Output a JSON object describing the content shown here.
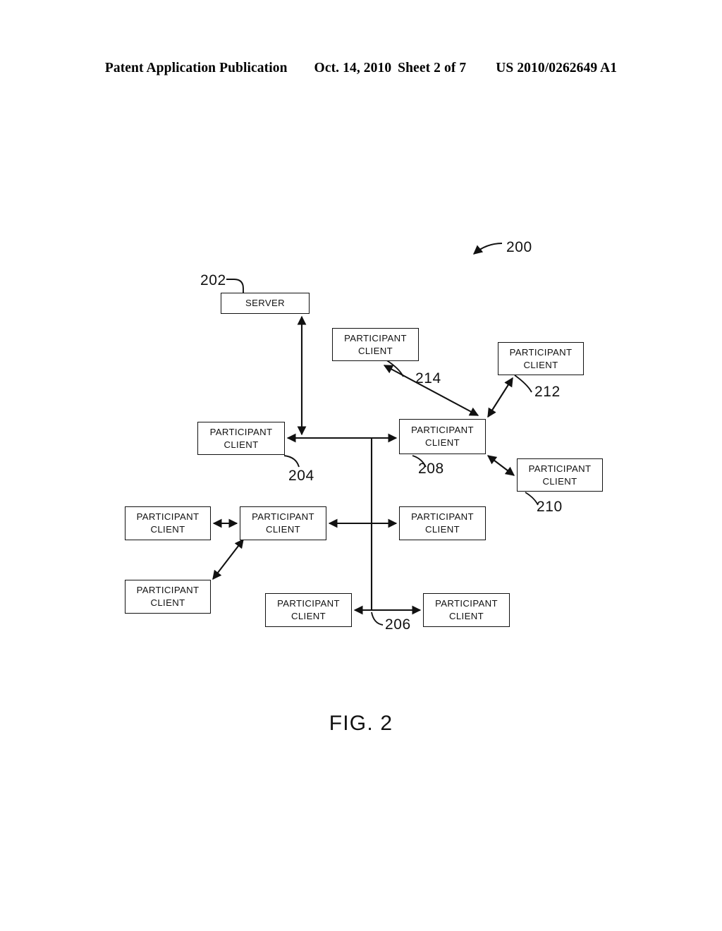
{
  "header": {
    "publication": "Patent Application Publication",
    "date": "Oct. 14, 2010",
    "sheet": "Sheet 2 of 7",
    "patent_number": "US 2010/0262649 A1"
  },
  "figure": {
    "caption": "FIG. 2",
    "diagram_label": "200",
    "node_label_server": "SERVER",
    "node_label_participant_line1": "PARTICIPANT",
    "node_label_participant_line2": "CLIENT"
  },
  "nodes": [
    {
      "id": "server",
      "type": "server",
      "ref": "202",
      "line1": "SERVER",
      "line2": ""
    },
    {
      "id": "n204",
      "type": "participant",
      "ref": "204",
      "line1": "PARTICIPANT",
      "line2": "CLIENT"
    },
    {
      "id": "n208",
      "type": "participant",
      "ref": "208",
      "line1": "PARTICIPANT",
      "line2": "CLIENT"
    },
    {
      "id": "n214",
      "type": "participant",
      "ref": "214",
      "line1": "PARTICIPANT",
      "line2": "CLIENT"
    },
    {
      "id": "n212",
      "type": "participant",
      "ref": "212",
      "line1": "PARTICIPANT",
      "line2": "CLIENT"
    },
    {
      "id": "n210",
      "type": "participant",
      "ref": "210",
      "line1": "PARTICIPANT",
      "line2": "CLIENT"
    },
    {
      "id": "mid_left",
      "type": "participant",
      "ref": "",
      "line1": "PARTICIPANT",
      "line2": "CLIENT"
    },
    {
      "id": "mid_center",
      "type": "participant",
      "ref": "",
      "line1": "PARTICIPANT",
      "line2": "CLIENT"
    },
    {
      "id": "mid_right",
      "type": "participant",
      "ref": "",
      "line1": "PARTICIPANT",
      "line2": "CLIENT"
    },
    {
      "id": "low_left",
      "type": "participant",
      "ref": "",
      "line1": "PARTICIPANT",
      "line2": "CLIENT"
    },
    {
      "id": "bot_left",
      "type": "participant",
      "ref": "206",
      "line1": "PARTICIPANT",
      "line2": "CLIENT"
    },
    {
      "id": "bot_right",
      "type": "participant",
      "ref": "",
      "line1": "PARTICIPANT",
      "line2": "CLIENT"
    }
  ],
  "reference_numerals": {
    "r200": "200",
    "r202": "202",
    "r204": "204",
    "r206": "206",
    "r208": "208",
    "r210": "210",
    "r212": "212",
    "r214": "214"
  },
  "colors": {
    "ink": "#111111",
    "paper": "#ffffff"
  }
}
